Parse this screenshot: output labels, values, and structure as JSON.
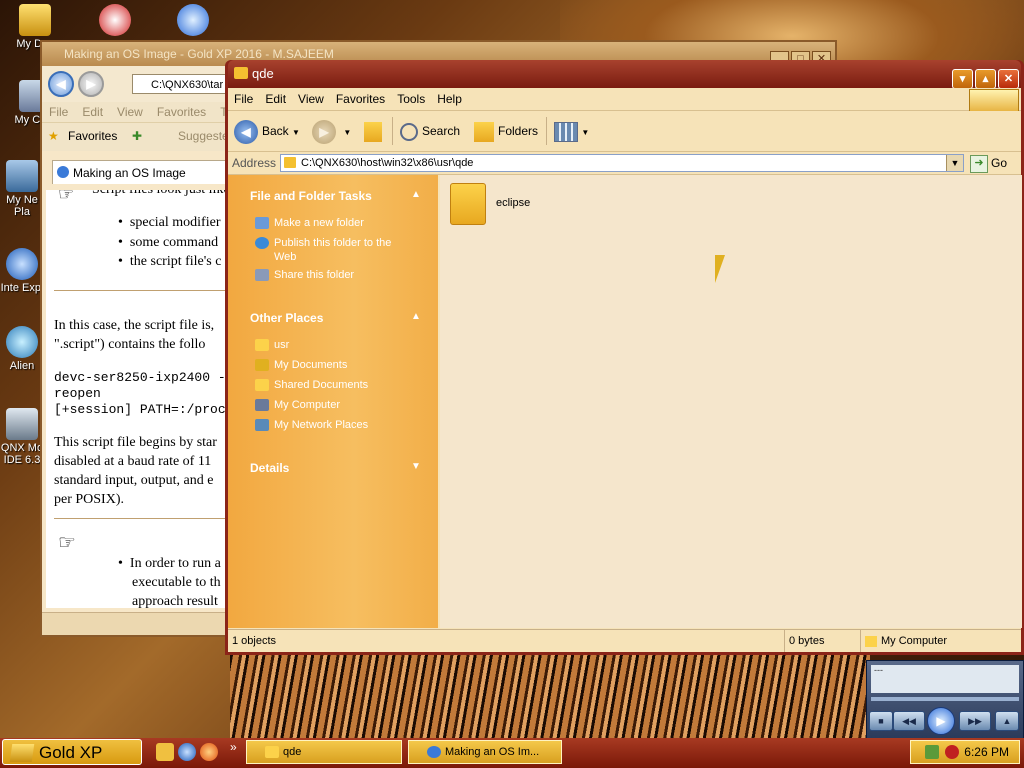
{
  "desktop": {
    "icons": [
      {
        "label": "My Doc"
      },
      {
        "label": "My Com"
      },
      {
        "label": "My Ne Pla"
      },
      {
        "label": "Inte Expl"
      },
      {
        "label": "Alien"
      },
      {
        "label": "QNX Mo IDE 6.3"
      }
    ]
  },
  "browser": {
    "title": "Making an OS Image - Gold XP 2016 - M.SAJEEM",
    "address": "C:\\QNX630\\tar",
    "menu": [
      "File",
      "Edit",
      "View",
      "Favorites",
      "T"
    ],
    "favorites_label": "Favorites",
    "suggested": "Suggeste",
    "tab_label": "Making an OS Image",
    "content": {
      "line0": "Script files look just like",
      "bullets": [
        "special modifier",
        "some command",
        "the script file's c"
      ],
      "para1": "In this case, the script file is,",
      "para1b": "\".script\") contains the follo",
      "code": [
        "devc-ser8250-ixp2400 -",
        "reopen",
        "[+session] PATH=:/proc"
      ],
      "para2": "This script file begins by star",
      "para2b": "disabled at a baud rate of 11",
      "para2c": "standard input, output, and e",
      "para2d": "per POSIX).",
      "bullet2a": "In order to run a",
      "bullet2b": "executable to th",
      "bullet2c": "approach result"
    }
  },
  "explorer": {
    "title": "qde",
    "menu": [
      "File",
      "Edit",
      "View",
      "Favorites",
      "Tools",
      "Help"
    ],
    "toolbar": {
      "back": "Back",
      "search": "Search",
      "folders": "Folders"
    },
    "address_label": "Address",
    "address_value": "C:\\QNX630\\host\\win32\\x86\\usr\\qde",
    "go_label": "Go",
    "tasks": {
      "header": "File and Folder Tasks",
      "items": [
        "Make a new folder",
        "Publish this folder to the",
        "Web",
        "Share this folder"
      ]
    },
    "places": {
      "header": "Other Places",
      "items": [
        "usr",
        "My Documents",
        "Shared Documents",
        "My Computer",
        "My Network Places"
      ]
    },
    "details_header": "Details",
    "files": [
      {
        "name": "eclipse"
      }
    ],
    "status": {
      "objects": "1 objects",
      "size": "0 bytes",
      "location": "My Computer"
    }
  },
  "mediaplayer": {
    "screen_text": "---"
  },
  "taskbar": {
    "start_label": "Gold XP",
    "quicklaunch_more": "»",
    "buttons": [
      "qde",
      "Making an OS Im..."
    ],
    "clock": "6:26 PM"
  },
  "colors": {
    "titlebar": "#8b2418",
    "taskpane": "#f6be60",
    "window_body": "#f6e3b8"
  }
}
